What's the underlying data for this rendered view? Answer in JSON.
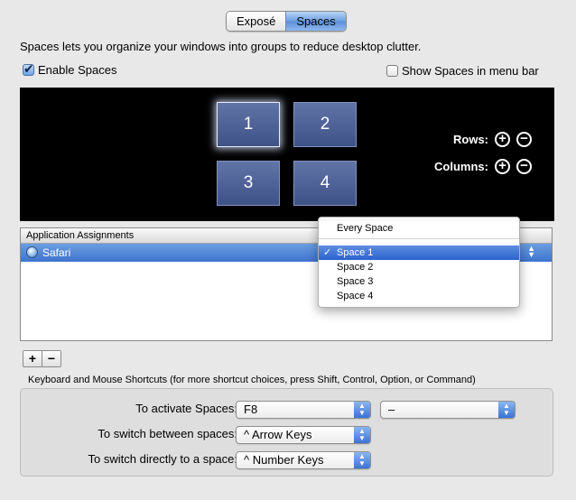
{
  "tabs": [
    {
      "label": "Exposé",
      "selected": false
    },
    {
      "label": "Spaces",
      "selected": true
    }
  ],
  "description": "Spaces lets you organize your windows into groups to reduce desktop clutter.",
  "enable_spaces": {
    "label": "Enable Spaces",
    "checked": true
  },
  "show_in_menu_bar": {
    "label": "Show Spaces in menu bar",
    "checked": false
  },
  "spaces": {
    "tiles": [
      "1",
      "2",
      "3",
      "4"
    ],
    "selected": "1",
    "rows_label": "Rows:",
    "columns_label": "Columns:"
  },
  "icons": {
    "add": "+",
    "remove": "−",
    "check": "✓",
    "arrows": "▲▼"
  },
  "assignments": {
    "header": "Application Assignments",
    "rows": [
      {
        "app": "Safari",
        "app_icon": "safari-icon",
        "space": "Space 1"
      }
    ]
  },
  "space_menu": {
    "items": [
      "Every Space",
      "Space 1",
      "Space 2",
      "Space 3",
      "Space 4"
    ],
    "selected": "Space 1"
  },
  "table_buttons": {
    "add": "+",
    "remove": "−"
  },
  "shortcuts": {
    "title": "Keyboard and Mouse Shortcuts (for more shortcut choices, press Shift, Control, Option, or Command)",
    "activate": {
      "label": "To activate Spaces:",
      "value": "F8",
      "secondary_value": "–"
    },
    "switch_between": {
      "label": "To switch between spaces:",
      "value": "^ Arrow Keys"
    },
    "switch_directly": {
      "label": "To switch directly to a space:",
      "value": "^ Number Keys"
    }
  }
}
